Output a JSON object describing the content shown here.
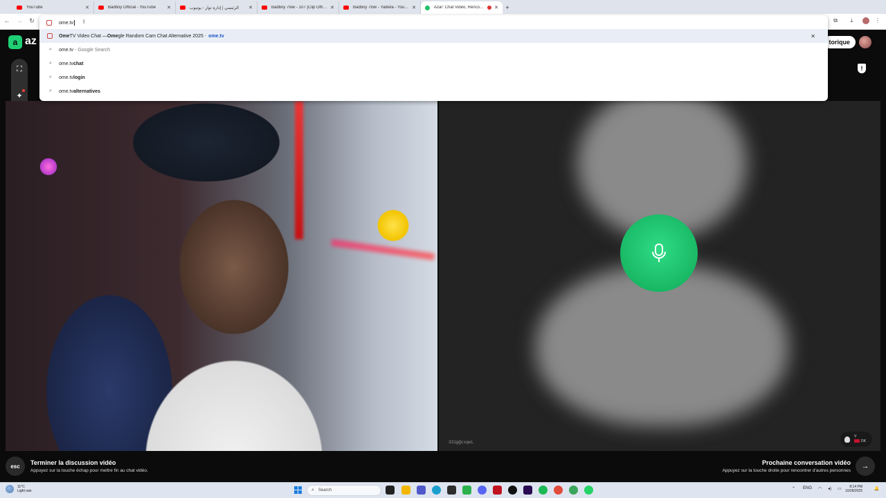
{
  "browser": {
    "tabs": [
      {
        "title": "YouTube",
        "favicon": "youtube-icon"
      },
      {
        "title": "Badboy Official - YouTube",
        "favicon": "youtube-icon"
      },
      {
        "title": "الرئيسي | إدارة ثوار - يوتيوب",
        "favicon": "youtube-icon"
      },
      {
        "title": "Badboy 7low - 107 [Clip Officiel]",
        "favicon": "youtube-icon"
      },
      {
        "title": "Badboy 7low - YaBeta - YouTube",
        "favicon": "youtube-icon"
      },
      {
        "title": "Azar: Chat Vidéo, Rencontre",
        "favicon": "azar-icon",
        "active": true,
        "recording": true
      }
    ],
    "new_tab_label": "+",
    "address_value": "ome.tv",
    "suggestions": [
      {
        "type": "page",
        "title_bold_1": "Ome",
        "title_rest_1": "TV Video Chat — ",
        "title_bold_2": "Ome",
        "title_rest_2": "gle Random Cam Chat Alternative 2025",
        "sep": " - ",
        "url": "ome.tv",
        "remove": "✕"
      },
      {
        "type": "search",
        "prefix": "ome.tv",
        "suffix": "",
        "dim": " - Google Search"
      },
      {
        "type": "search",
        "prefix": "ome.tv",
        "suffix": " chat"
      },
      {
        "type": "search",
        "prefix": "ome.tv",
        "suffix": " login"
      },
      {
        "type": "search",
        "prefix": "ome.tv",
        "suffix": " alternatives"
      }
    ]
  },
  "app": {
    "logo_letter": "a",
    "logo_text": "az",
    "history_button": "torique",
    "accent": "#1fcf74"
  },
  "remote": {
    "user_id": "331gQcxqeL",
    "country_top": "V",
    "country_code": "DK"
  },
  "bottom": {
    "esc_key": "esc",
    "end_title": "Terminer la discussion vidéo",
    "end_sub": "Appuyez sur la touche échap pour mettre fin au chat vidéo.",
    "next_title": "Prochaine conversation vidéo",
    "next_sub": "Appuyez sur la touche droite pour rencontrer d'autres personnes",
    "next_key": "→"
  },
  "taskbar": {
    "weather_temp": "11°C",
    "weather_desc": "Light rain",
    "search_placeholder": "Search",
    "lang": "ENG",
    "time": "8:14 PM",
    "date": "10/28/2025"
  }
}
